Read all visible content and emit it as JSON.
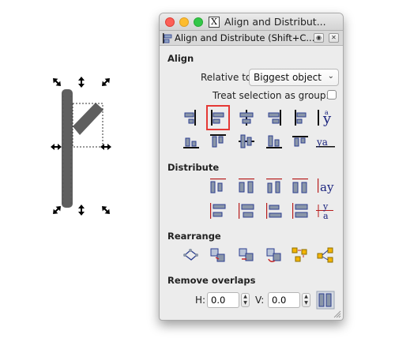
{
  "canvas": {
    "object_color": "#5f5f5f",
    "handle_color": "#000000"
  },
  "window": {
    "title": "Align and Distribut...",
    "x11_icon": "X",
    "tab_label": "Align and Distribute (Shift+C...",
    "tab_icon": "align-distribute-icon",
    "traffic_lights": [
      "close",
      "minimize",
      "zoom"
    ]
  },
  "align": {
    "heading": "Align",
    "relative_label": "Relative to:",
    "relative_value": "Biggest object",
    "group_label": "Treat selection as group:",
    "group_checked": false,
    "selected_icon": "align-left-edges-icon"
  },
  "distribute": {
    "heading": "Distribute"
  },
  "rearrange": {
    "heading": "Rearrange"
  },
  "overlaps": {
    "heading": "Remove overlaps",
    "h_label": "H:",
    "h_value": "0.0",
    "v_label": "V:",
    "v_value": "0.0"
  },
  "colors": {
    "accent_selected": "#e53935",
    "icon_blue": "#2c3e8f",
    "icon_gray": "#8a96a8"
  }
}
